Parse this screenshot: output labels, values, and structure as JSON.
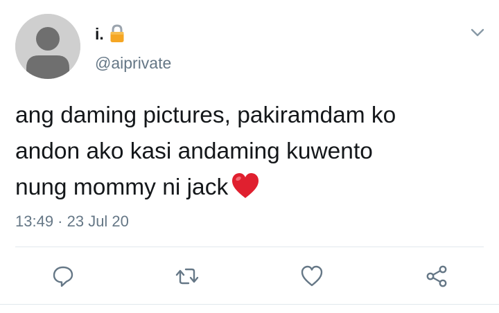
{
  "user": {
    "display_name": "i.",
    "handle": "@aiprivate",
    "avatar_icon": "default-avatar-icon",
    "protected_icon": "lock-icon"
  },
  "tweet": {
    "text": "ang daming pictures, pakiramdam ko\nandon ako kasi andaming kuwento\nnung mommy ni jack",
    "emoji": "red-heart-emoji",
    "timestamp": "13:49 · 23 Jul 20"
  },
  "actions": [
    {
      "name": "reply",
      "icon": "reply-icon"
    },
    {
      "name": "retweet",
      "icon": "retweet-icon"
    },
    {
      "name": "like",
      "icon": "like-icon"
    },
    {
      "name": "share",
      "icon": "share-icon"
    }
  ],
  "colors": {
    "text_primary": "#14171a",
    "text_secondary": "#657786",
    "icon_gray": "#657786",
    "divider": "#e1e8ed",
    "avatar_bg": "#cfcfcf",
    "avatar_fg": "#6f6f6f",
    "heart_red": "#e0202f",
    "lock_gold": "#f5a623"
  }
}
